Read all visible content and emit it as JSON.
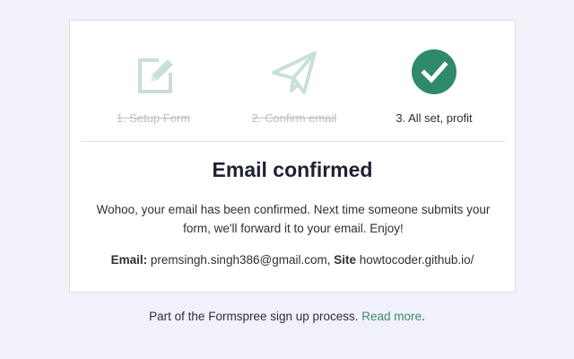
{
  "colors": {
    "page_background": "#f1f2f9",
    "card_background": "#ffffff",
    "accent": "#2f8a69",
    "faded_step": "#c9e0d6",
    "link": "#3c8a6d"
  },
  "steps": [
    {
      "label": "1. Setup Form",
      "icon": "edit-form-icon",
      "status": "done"
    },
    {
      "label": "2. Confirm email",
      "icon": "paper-plane-icon",
      "status": "done"
    },
    {
      "label": "3. All set, profit",
      "icon": "checkmark-circle-icon",
      "status": "current"
    }
  ],
  "confirmation": {
    "title": "Email confirmed",
    "message": "Wohoo, your email has been confirmed. Next time someone submits your form, we'll forward it to your email. Enjoy!",
    "email_label": "Email:",
    "email_value": "premsingh.singh386@gmail.com,",
    "site_label": "Site",
    "site_value": "howtocoder.github.io/"
  },
  "footer": {
    "text": "Part of the Formspree sign up process.",
    "link_text": "Read more",
    "trailing": "."
  }
}
